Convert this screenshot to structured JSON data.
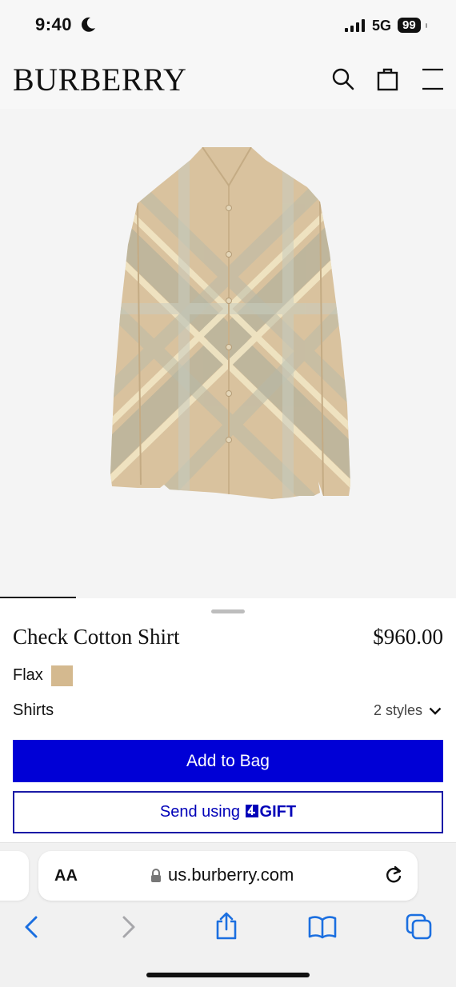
{
  "status_bar": {
    "time": "9:40",
    "network": "5G",
    "battery": "99"
  },
  "header": {
    "logo": "BURBERRY"
  },
  "product": {
    "name": "Check Cotton Shirt",
    "price": "$960.00",
    "color_name": "Flax",
    "swatch_color": "#d4b98f",
    "category": "Shirts",
    "styles_label": "2 styles",
    "add_to_bag": "Add to Bag",
    "send_prefix": "Send using ",
    "gift_brand": "GIFT"
  },
  "browser": {
    "text_size": "AA",
    "url": "us.burberry.com"
  },
  "colors": {
    "accent": "#0000d6",
    "gift_text": "#0000b8",
    "link_blue": "#1b6fe0"
  }
}
